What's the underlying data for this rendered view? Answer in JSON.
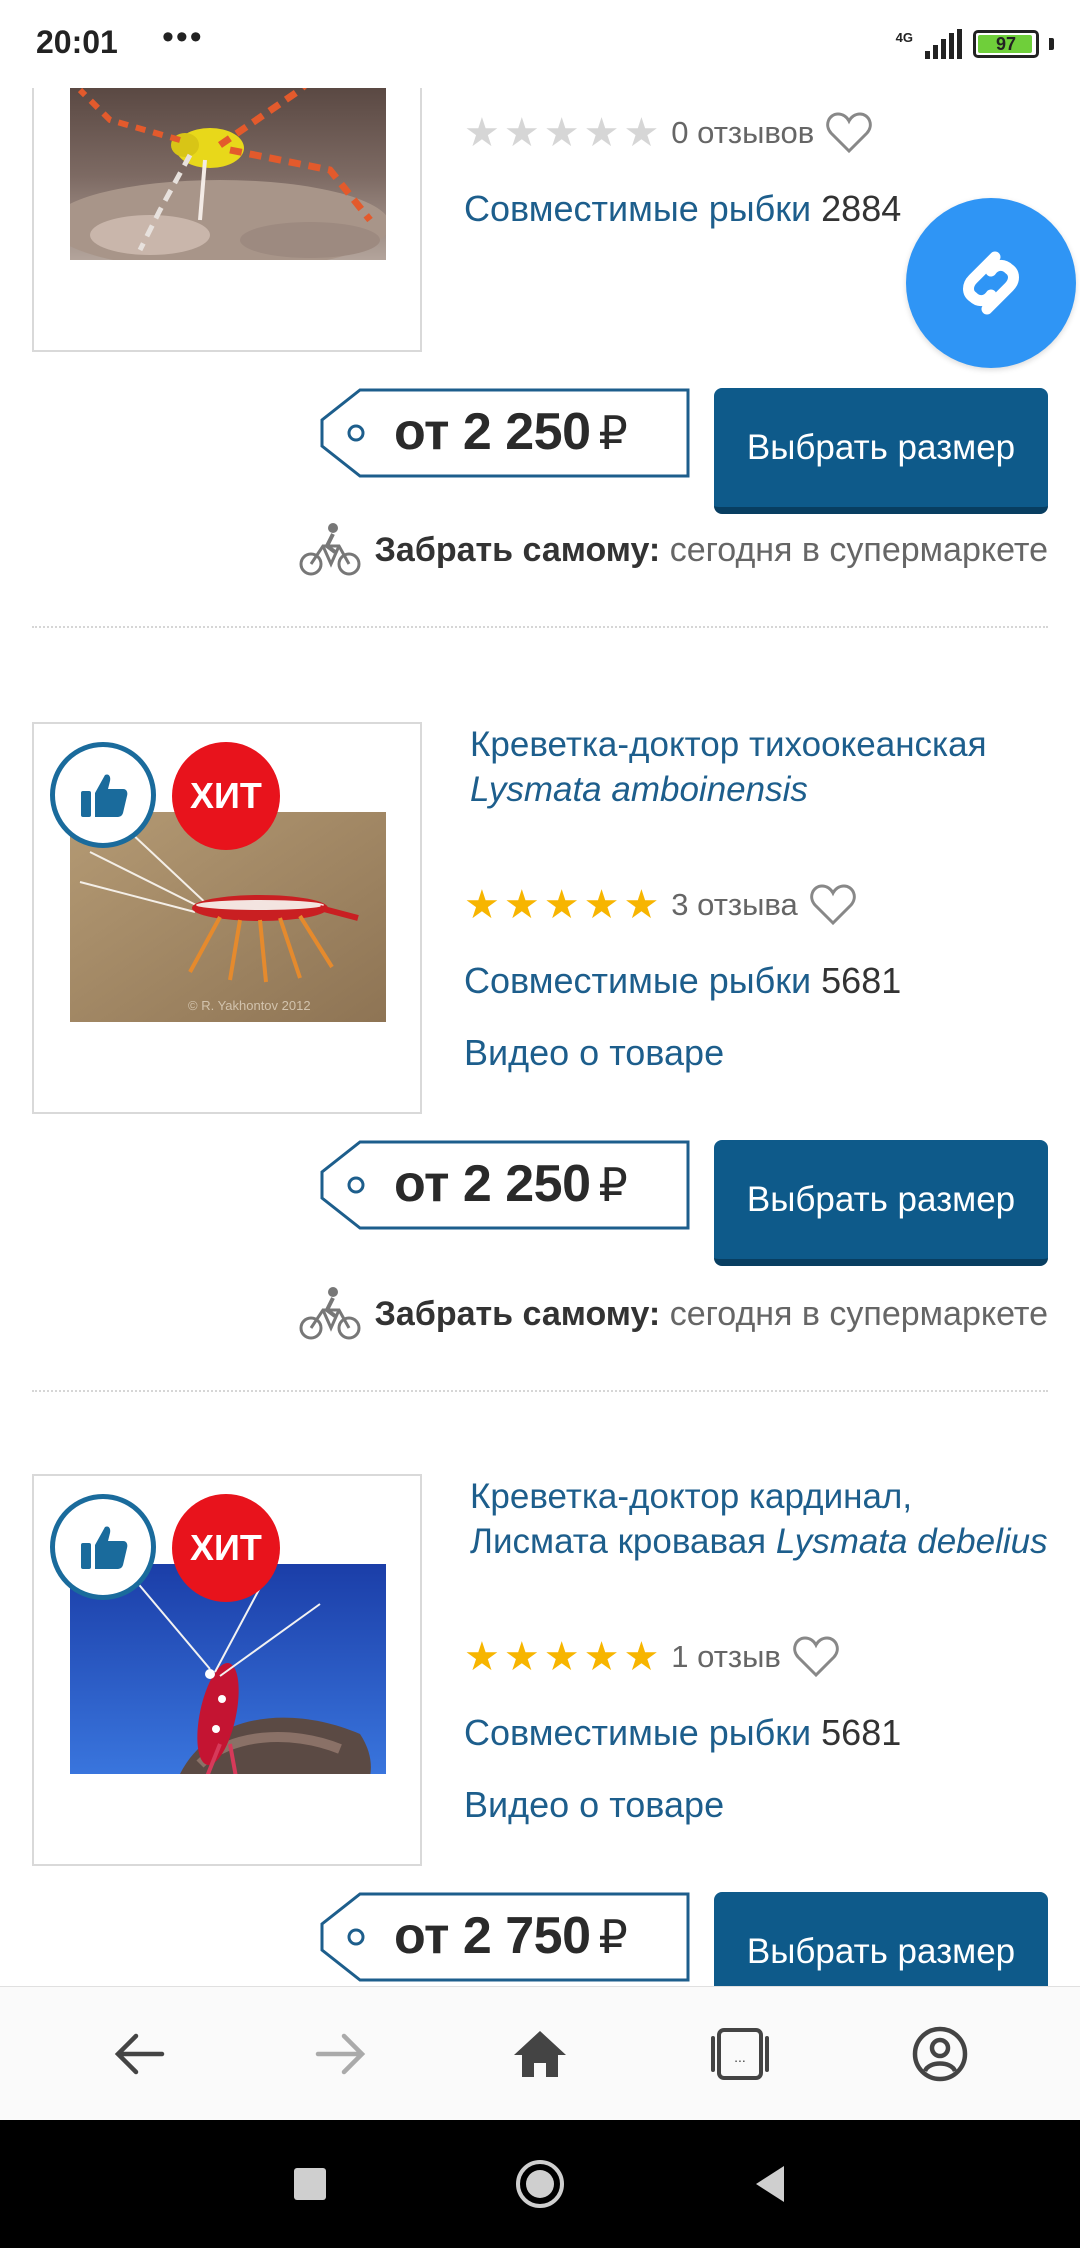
{
  "status_bar": {
    "time": "20:01",
    "dots": "•••",
    "network": "4G",
    "battery": "97"
  },
  "products": [
    {
      "title_plain": "",
      "title_italic": "",
      "stars": 0,
      "reviews": "0 отзывов",
      "compat_label": "Совместимые рыбки",
      "compat_count": "2884",
      "video": "",
      "price": "от 2 250",
      "currency": "₽",
      "button": "Выбрать размер",
      "pickup_bold": "Забрать самому:",
      "pickup_rest": "сегодня в супермаркете"
    },
    {
      "badge_hit": "ХИТ",
      "title_plain": "Креветка-доктор тихоокеанская",
      "title_italic": "Lysmata amboinensis",
      "stars": 5,
      "reviews": "3 отзыва",
      "compat_label": "Совместимые рыбки",
      "compat_count": "5681",
      "video": "Видео о товаре",
      "price": "от 2 250",
      "currency": "₽",
      "button": "Выбрать размер",
      "pickup_bold": "Забрать самому:",
      "pickup_rest": "сегодня в супермаркете"
    },
    {
      "badge_hit": "ХИТ",
      "title_plain": "Креветка-доктор кардинал, Лисмата кровавая",
      "title_italic": "Lysmata debelius",
      "stars": 5,
      "reviews": "1 отзыв",
      "compat_label": "Совместимые рыбки",
      "compat_count": "5681",
      "video": "Видео о товаре",
      "price": "от 2 750",
      "currency": "₽",
      "button": "Выбрать размер"
    }
  ],
  "colors": {
    "link": "#1d5e8c",
    "button": "#0e5a8a",
    "star": "#f7b500",
    "hit": "#e8131c",
    "shazam": "#2f95f5"
  },
  "icons": {
    "bike": "bicycle-courier-icon",
    "heart": "heart-outline-icon",
    "like": "thumbs-up-icon",
    "shazam": "shazam-icon"
  }
}
